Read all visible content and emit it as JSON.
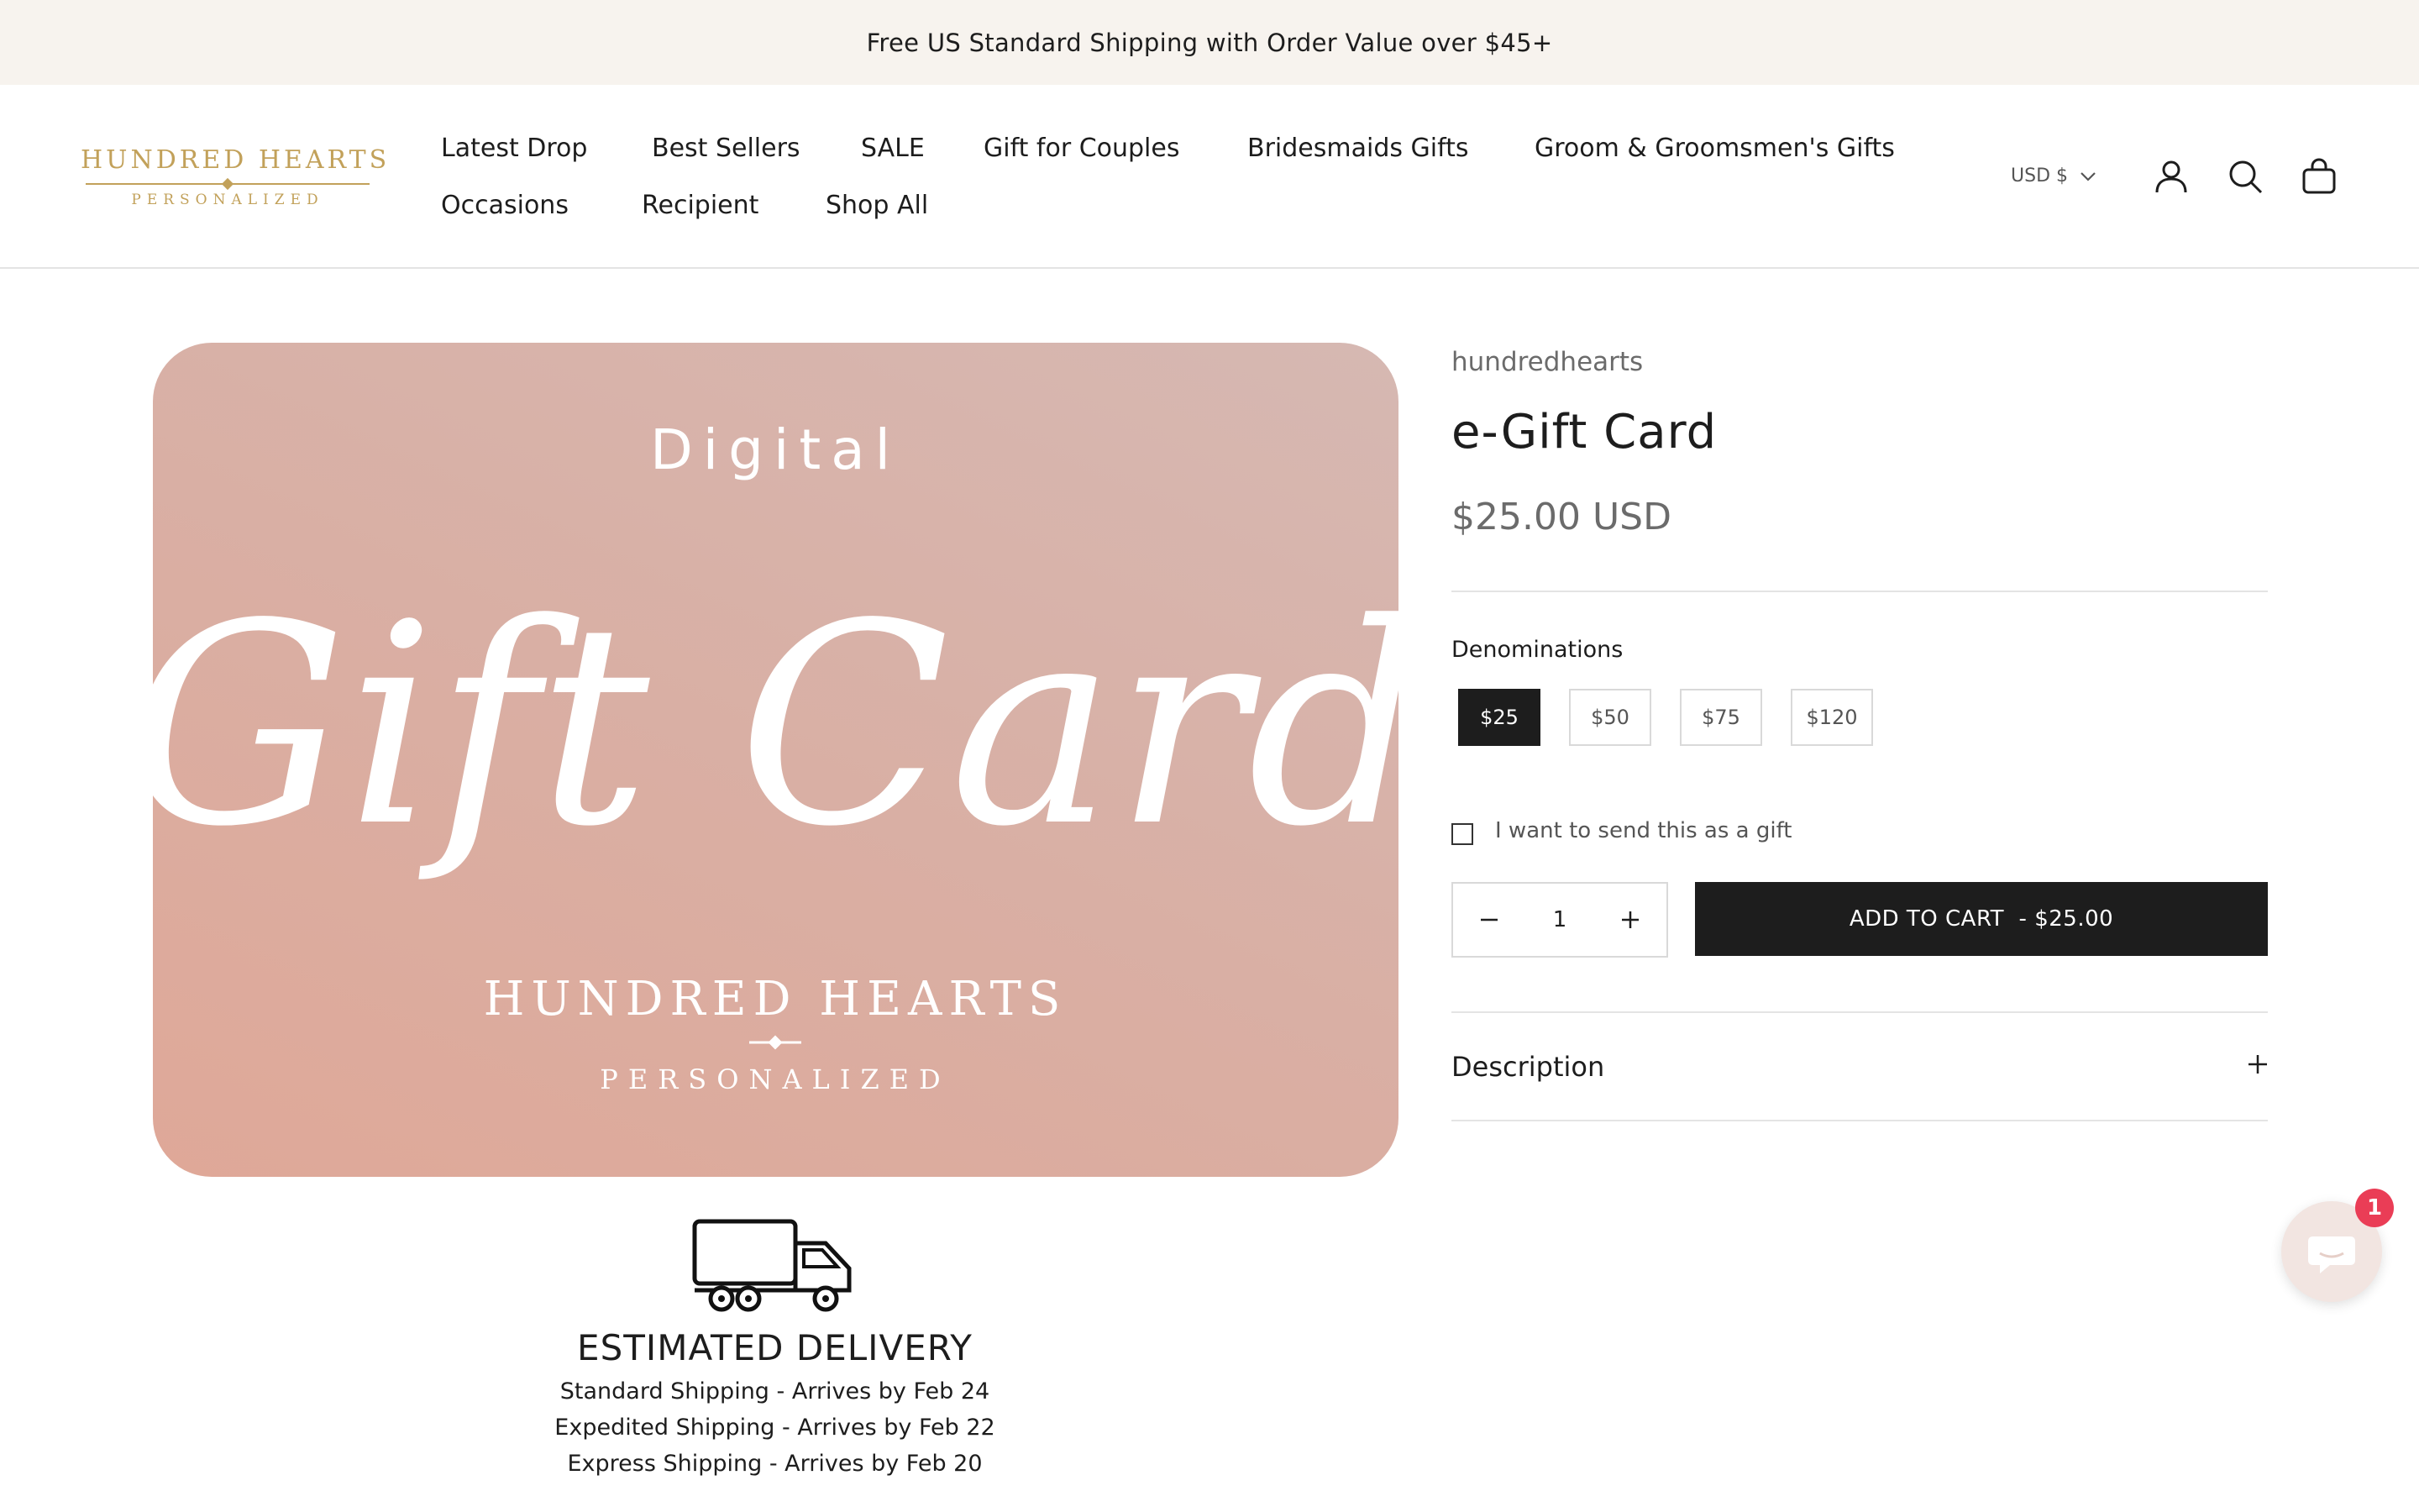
{
  "announcement": "Free US Standard Shipping with Order Value over $45+",
  "logo": {
    "main": "HUNDRED HEARTS",
    "sub": "PERSONALIZED"
  },
  "nav": {
    "row1": [
      "Latest Drop",
      "Best Sellers",
      "SALE",
      "Gift for Couples",
      "Bridesmaids Gifts",
      "Groom & Groomsmen's Gifts"
    ],
    "row2": [
      "Occasions",
      "Recipient",
      "Shop All"
    ]
  },
  "header_actions": {
    "currency": "USD $",
    "icons": [
      "account-icon",
      "search-icon",
      "cart-bag-icon"
    ]
  },
  "gallery": {
    "card_top": "Digital",
    "card_script": "Gift Card",
    "card_brand": "HUNDRED HEARTS",
    "card_brand_sub": "PERSONALIZED"
  },
  "delivery": {
    "title": "ESTIMATED DELIVERY",
    "lines": [
      "Standard Shipping - Arrives by Feb 24",
      "Expedited Shipping - Arrives by Feb 22",
      "Express Shipping - Arrives by Feb 20"
    ]
  },
  "product": {
    "vendor": "hundredhearts",
    "title": "e-Gift Card",
    "price": "$25.00 USD",
    "denominations_label": "Denominations",
    "denominations": [
      "$25",
      "$50",
      "$75",
      "$120"
    ],
    "selected_denomination": "$25",
    "gift_option_label": "I want to send this as a gift",
    "gift_option_checked": false,
    "quantity": "1",
    "add_to_cart_label": "ADD TO CART  - $25.00",
    "description_label": "Description"
  },
  "chat": {
    "unread_count": "1"
  },
  "colors": {
    "announcement_bg": "#f7f3ee",
    "brand_gold": "#c2a15a",
    "button_dark": "#1d1d1d",
    "card_pink": "#d9afa4",
    "badge_red": "#ea3d56"
  }
}
